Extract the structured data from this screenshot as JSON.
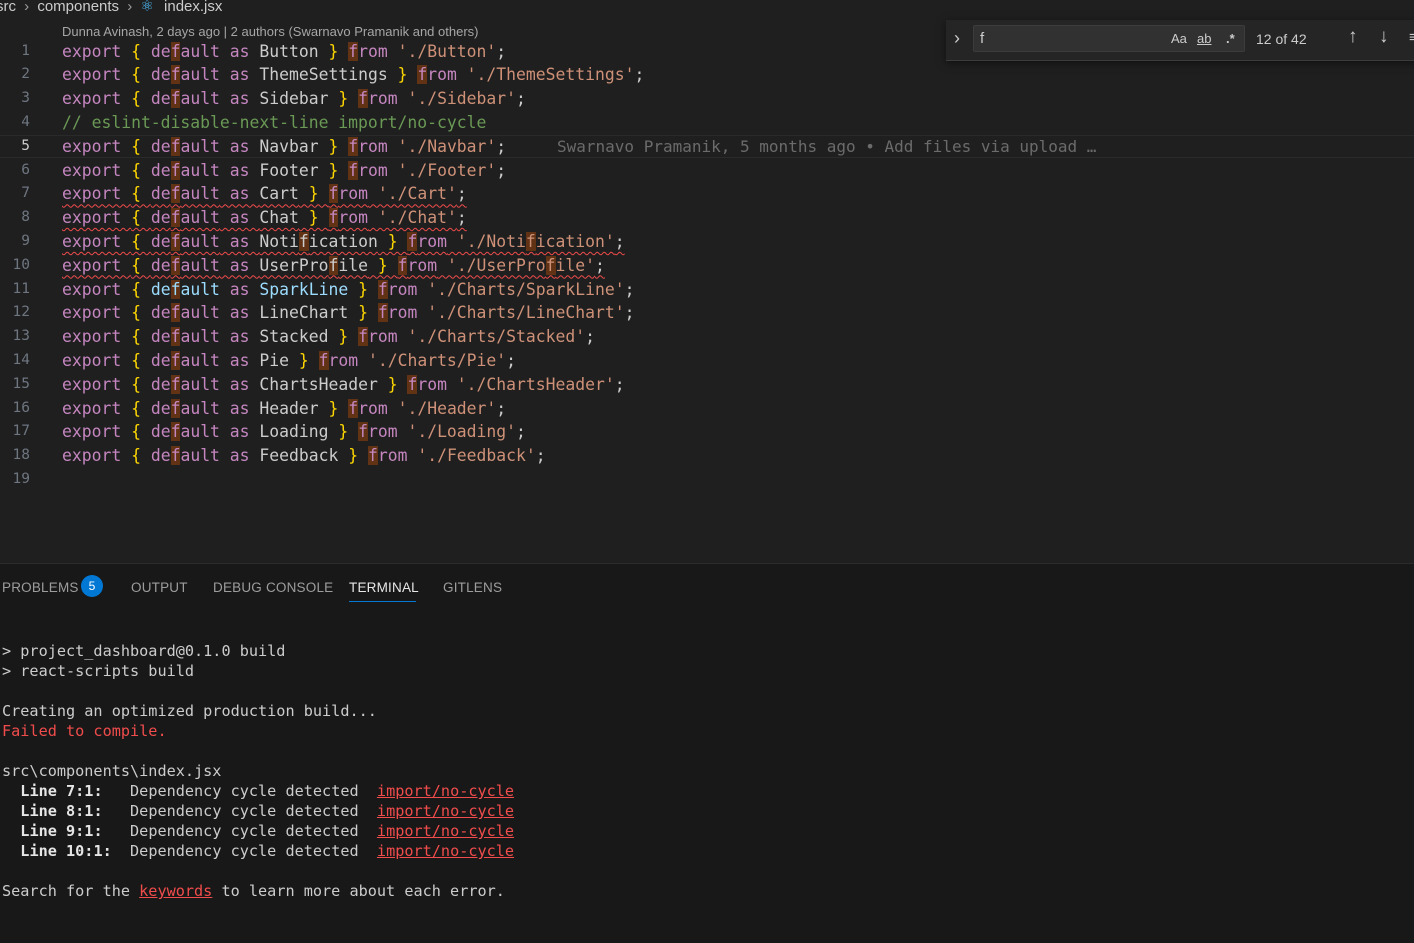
{
  "breadcrumb": {
    "segments": [
      "src",
      "components"
    ],
    "file": "index.jsx",
    "file_icon": "react-icon"
  },
  "codelens": "Dunna Avinash, 2 days ago | 2 authors (Swarnavo Pramanik and others)",
  "editor": {
    "active_line": 5,
    "blame": "Swarnavo Pramanik, 5 months ago • Add files via upload …",
    "lines": [
      {
        "n": "1",
        "type": "export",
        "name": "Button",
        "path": "./Button"
      },
      {
        "n": "2",
        "type": "export",
        "name": "ThemeSettings",
        "path": "./ThemeSettings"
      },
      {
        "n": "3",
        "type": "export",
        "name": "Sidebar",
        "path": "./Sidebar"
      },
      {
        "n": "4",
        "type": "comment",
        "text": "// eslint-disable-next-line import/no-cycle"
      },
      {
        "n": "5",
        "type": "export",
        "name": "Navbar",
        "path": "./Navbar"
      },
      {
        "n": "6",
        "type": "export",
        "name": "Footer",
        "path": "./Footer"
      },
      {
        "n": "7",
        "type": "export",
        "name": "Cart",
        "path": "./Cart",
        "error": true
      },
      {
        "n": "8",
        "type": "export",
        "name": "Chat",
        "path": "./Chat",
        "error": true
      },
      {
        "n": "9",
        "type": "export",
        "name": "Notification",
        "path": "./Notification",
        "error": true
      },
      {
        "n": "10",
        "type": "export",
        "name": "UserProfile",
        "path": "./UserProfile",
        "error": true
      },
      {
        "n": "11",
        "type": "export",
        "name": "SparkLine",
        "path": "./Charts/SparkLine",
        "var": true
      },
      {
        "n": "12",
        "type": "export",
        "name": "LineChart",
        "path": "./Charts/LineChart"
      },
      {
        "n": "13",
        "type": "export",
        "name": "Stacked",
        "path": "./Charts/Stacked"
      },
      {
        "n": "14",
        "type": "export",
        "name": "Pie",
        "path": "./Charts/Pie"
      },
      {
        "n": "15",
        "type": "export",
        "name": "ChartsHeader",
        "path": "./ChartsHeader"
      },
      {
        "n": "16",
        "type": "export",
        "name": "Header",
        "path": "./Header"
      },
      {
        "n": "17",
        "type": "export",
        "name": "Loading",
        "path": "./Loading"
      },
      {
        "n": "18",
        "type": "export",
        "name": "Feedback",
        "path": "./Feedback"
      },
      {
        "n": "19",
        "type": "empty"
      }
    ]
  },
  "find": {
    "query": "f",
    "match_case_label": "Aa",
    "whole_word_label": "ab",
    "regex_label": ".*",
    "count": "12 of 42",
    "toggle_icon": "chevron-right-icon",
    "prev_icon": "arrow-up-icon",
    "next_icon": "arrow-down-icon"
  },
  "panel": {
    "tabs": [
      {
        "label": "PROBLEMS",
        "active": false
      },
      {
        "label": "OUTPUT",
        "active": false
      },
      {
        "label": "DEBUG CONSOLE",
        "active": false
      },
      {
        "label": "TERMINAL",
        "active": true
      },
      {
        "label": "GITLENS",
        "active": false
      }
    ],
    "problems_count": "5",
    "accent": "#0078d4"
  },
  "terminal": {
    "cmd1": "> project_dashboard@0.1.0 build",
    "cmd2": "> react-scripts build",
    "creating": "Creating an optimized production build...",
    "failed": "Failed to compile.",
    "file": "src\\components\\index.jsx",
    "errors": [
      {
        "loc": "Line 7:1:",
        "msg": "Dependency cycle detected",
        "rule": "import/no-cycle"
      },
      {
        "loc": "Line 8:1:",
        "msg": "Dependency cycle detected",
        "rule": "import/no-cycle"
      },
      {
        "loc": "Line 9:1:",
        "msg": "Dependency cycle detected",
        "rule": "import/no-cycle"
      },
      {
        "loc": "Line 10:1:",
        "msg": "Dependency cycle detected",
        "rule": "import/no-cycle"
      }
    ],
    "search_prefix": "Search for the ",
    "search_link": "keywords",
    "search_suffix": " to learn more about each error."
  },
  "colors": {
    "keyword": "#c586c0",
    "bracket": "#ffd700",
    "string": "#ce9178",
    "comment": "#6a9955",
    "error": "#f14c4c"
  }
}
